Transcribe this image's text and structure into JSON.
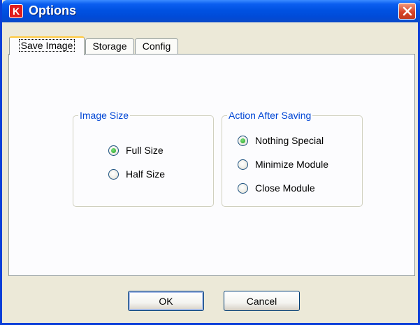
{
  "window": {
    "title": "Options",
    "app_icon_letter": "K"
  },
  "tabs": [
    {
      "label": "Save Image",
      "active": true
    },
    {
      "label": "Storage",
      "active": false
    },
    {
      "label": "Config",
      "active": false
    }
  ],
  "image_size_group": {
    "legend": "Image Size",
    "options": [
      {
        "label": "Full Size",
        "checked": true
      },
      {
        "label": "Half Size",
        "checked": false
      }
    ]
  },
  "action_group": {
    "legend": "Action After Saving",
    "options": [
      {
        "label": "Nothing Special",
        "checked": true
      },
      {
        "label": "Minimize Module",
        "checked": false
      },
      {
        "label": "Close Module",
        "checked": false
      }
    ]
  },
  "buttons": {
    "ok_label": "OK",
    "cancel_label": "Cancel"
  },
  "colors": {
    "titlebar": "#0052e2",
    "legend_text": "#0046d5",
    "close_button": "#d8452a",
    "dialog_face": "#ece9d8"
  }
}
